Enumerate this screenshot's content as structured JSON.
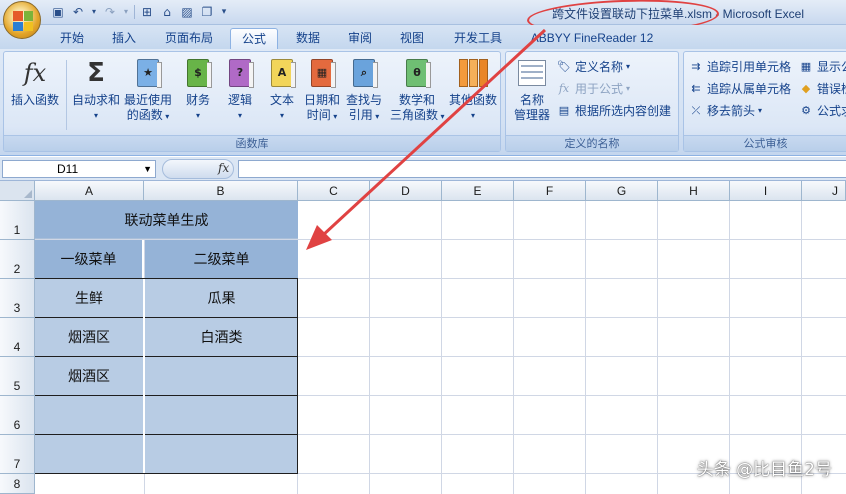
{
  "titlebar": {
    "title": "跨文件设置联动下拉菜单.xlsm - Microsoft Excel"
  },
  "qat_icons": [
    "save-icon",
    "undo-icon",
    "redo-icon",
    "org-chart-icon",
    "home-icon",
    "picture-icon",
    "window-icon",
    "customize-qat-icon"
  ],
  "tabs": [
    {
      "label": "开始"
    },
    {
      "label": "插入"
    },
    {
      "label": "页面布局"
    },
    {
      "label": "公式",
      "active": true
    },
    {
      "label": "数据"
    },
    {
      "label": "审阅"
    },
    {
      "label": "视图"
    },
    {
      "label": "开发工具"
    },
    {
      "label": "ABBYY FineReader 12"
    }
  ],
  "ribbon": {
    "function_library": {
      "label": "函数库",
      "insert_function": "插入函数",
      "autosum_l1": "自动求和",
      "recent_l1": "最近使用",
      "recent_l2": "的函数",
      "financial": "财务",
      "logical": "逻辑",
      "text": "文本",
      "datetime_l1": "日期和",
      "datetime_l2": "时间",
      "lookup_l1": "查找与",
      "lookup_l2": "引用",
      "math_l1": "数学和",
      "math_l2": "三角函数",
      "more": "其他函数"
    },
    "defined_names": {
      "label": "定义的名称",
      "name_manager_l1": "名称",
      "name_manager_l2": "管理器",
      "define_name": "定义名称",
      "use_in_formula": "用于公式",
      "create_from_selection": "根据所选内容创建"
    },
    "formula_auditing": {
      "label": "公式审核",
      "trace_precedents": "追踪引用单元格",
      "trace_dependents": "追踪从属单元格",
      "remove_arrows": "移去箭头",
      "show_formulas": "显示公",
      "error_checking": "错误检",
      "evaluate": "公式求"
    }
  },
  "formula_bar": {
    "name_box": "D11",
    "fx": "fx",
    "formula": ""
  },
  "sheet": {
    "columns": [
      "A",
      "B",
      "C",
      "D",
      "E",
      "F",
      "G",
      "H",
      "I",
      "J"
    ],
    "rows": [
      "1",
      "2",
      "3",
      "4",
      "5",
      "6",
      "7",
      "8"
    ],
    "title": "联动菜单生成",
    "header_a": "一级菜单",
    "header_b": "二级菜单",
    "a3": "生鲜",
    "b3": "瓜果",
    "a4": "烟酒区",
    "b4": "白酒类",
    "a5": "烟酒区",
    "b5": "",
    "a6": "",
    "b6": "",
    "a7": "",
    "b7": ""
  },
  "annotation": {
    "color": "#e04242"
  },
  "watermark": "头条 @比目鱼2号"
}
